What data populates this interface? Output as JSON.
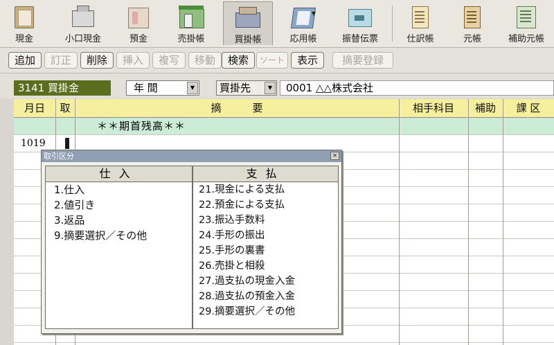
{
  "toolbar": {
    "items": [
      {
        "label": "現金",
        "icon": "cash-icon"
      },
      {
        "label": "小口現金",
        "icon": "petty-cash-icon"
      },
      {
        "label": "預金",
        "icon": "deposit-icon"
      },
      {
        "label": "売掛帳",
        "icon": "receivables-icon"
      },
      {
        "label": "買掛帳",
        "icon": "payables-icon"
      },
      {
        "label": "応用帳",
        "icon": "applied-ledger-icon"
      },
      {
        "label": "振替伝票",
        "icon": "transfer-slip-icon"
      },
      {
        "label": "仕訳帳",
        "icon": "journal-icon"
      },
      {
        "label": "元帳",
        "icon": "general-ledger-icon"
      },
      {
        "label": "補助元帳",
        "icon": "sub-ledger-icon"
      }
    ],
    "active_index": 4
  },
  "actions": {
    "add": "追加",
    "correct": "訂正",
    "delete": "削除",
    "insert": "挿入",
    "copy": "複写",
    "move": "移動",
    "search": "検索",
    "sort": "ソート",
    "display": "表示",
    "summary_register": "摘要登録"
  },
  "account": {
    "code_name": "3141 買掛金",
    "period": "年 間",
    "vendor_label": "買掛先",
    "vendor_value": "0001 △△株式会社"
  },
  "grid": {
    "headers": {
      "date": "月日",
      "type": "取",
      "summary": "摘　　　要",
      "counter_account": "相手科目",
      "auxiliary": "補助",
      "tax": "課 区"
    },
    "opening_balance": "＊＊期首残高＊＊",
    "entry_date": "1019"
  },
  "popup": {
    "title": "取引区分",
    "left_header": "仕入",
    "right_header": "支払",
    "left_options": [
      "1.仕入",
      "2.値引き",
      "3.返品",
      "9.摘要選択／その他"
    ],
    "right_options": [
      "21.現金による支払",
      "22.預金による支払",
      "23.振込手数料",
      "24.手形の振出",
      "25.手形の裏書",
      "26.売掛と相殺",
      "27.過支払の現金入金",
      "28.過支払の預金入金",
      "29.摘要選択／その他"
    ]
  },
  "colors": {
    "account_bg": "#5a6e1e",
    "header_bg": "#f6ef9e",
    "opening_row_bg": "#cdecd8",
    "popup_title_bg": "#8fa0b5"
  }
}
